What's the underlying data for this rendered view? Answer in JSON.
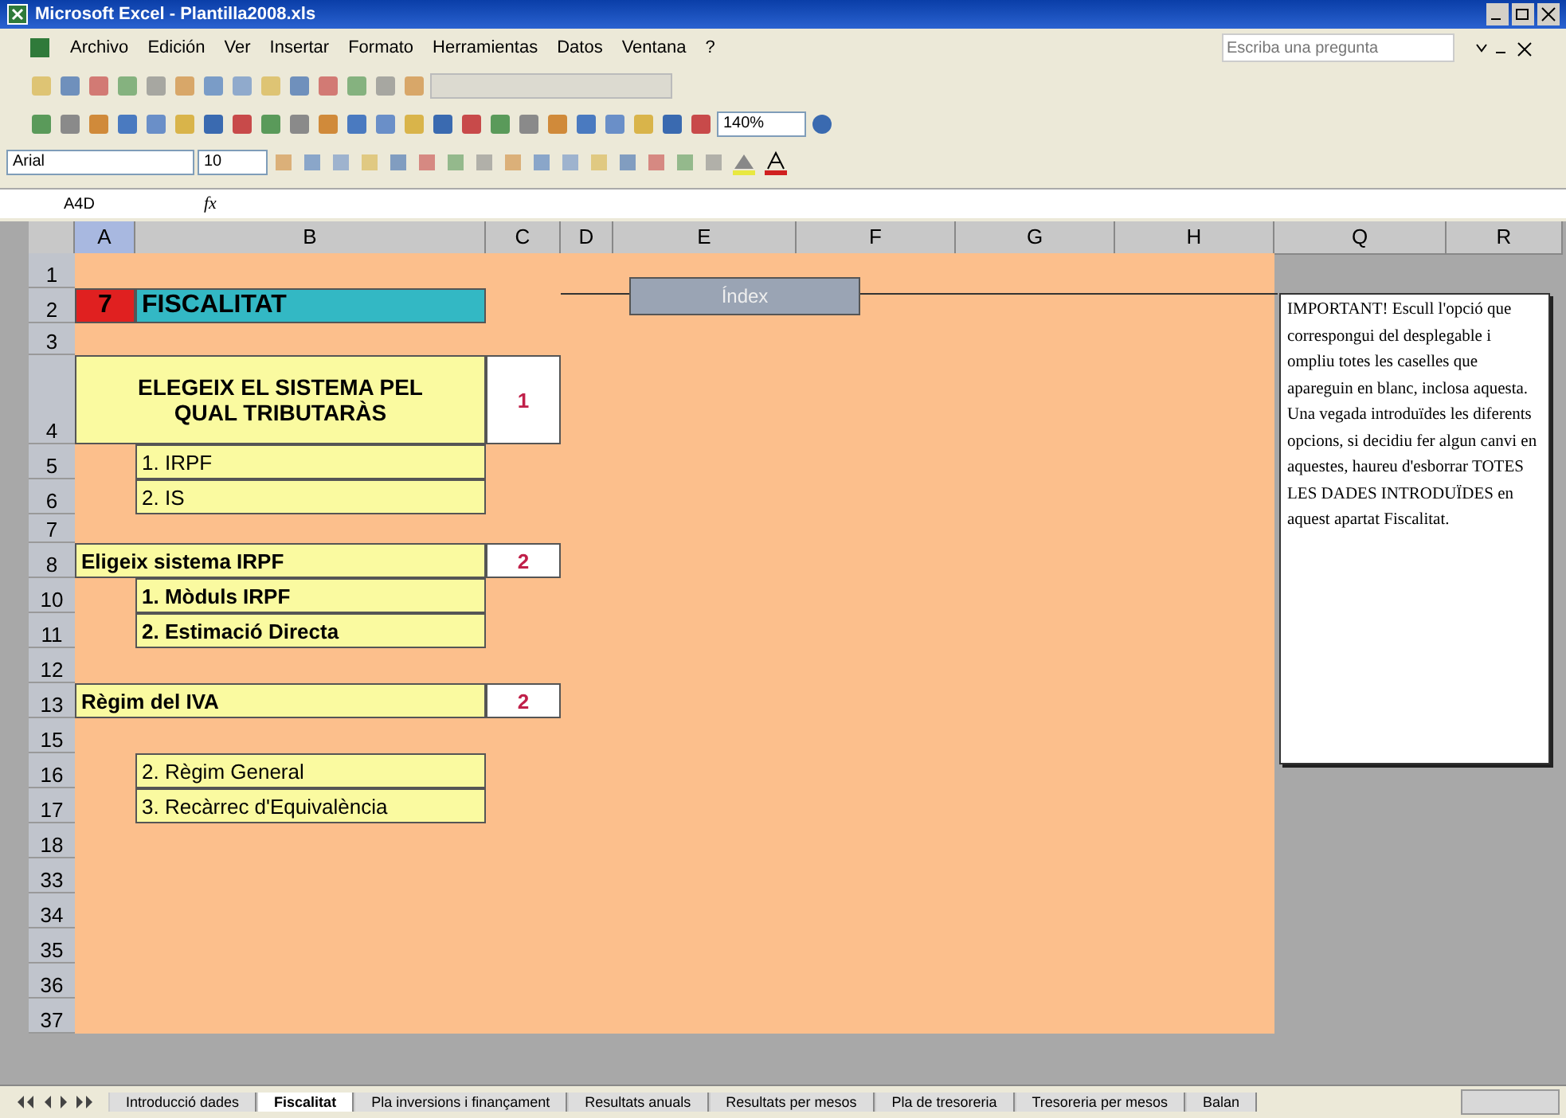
{
  "window": {
    "title": "Microsoft Excel - Plantilla2008.xls"
  },
  "menu": [
    "Archivo",
    "Edición",
    "Ver",
    "Insertar",
    "Formato",
    "Herramientas",
    "Datos",
    "Ventana",
    "?"
  ],
  "help_box": {
    "placeholder": "Escriba una pregunta"
  },
  "toolbar": {
    "zoom": "140%",
    "font": "Arial",
    "font_size": "10"
  },
  "formula_bar": {
    "name_box": "A4D",
    "fx": "fx"
  },
  "columns": [
    {
      "label": "A",
      "selected": true
    },
    {
      "label": "B",
      "selected": false
    },
    {
      "label": "C",
      "selected": false
    },
    {
      "label": "D",
      "selected": false
    },
    {
      "label": "E",
      "selected": false
    },
    {
      "label": "F",
      "selected": false
    },
    {
      "label": "G",
      "selected": false
    },
    {
      "label": "H",
      "selected": false
    },
    {
      "label": "Q",
      "selected": false
    },
    {
      "label": "R",
      "selected": false
    }
  ],
  "rows": [
    {
      "number": "1",
      "cells": []
    },
    {
      "number": "2",
      "cells": [
        {
          "kind": "section-number",
          "text": "7"
        },
        {
          "kind": "title",
          "text": "FISCALITAT"
        }
      ]
    },
    {
      "number": "3",
      "cells": []
    },
    {
      "number": "4",
      "cells": [
        {
          "kind": "heading",
          "text": "ELEGEIX EL SISTEMA PEL QUAL TRIBUTARÀS"
        },
        {
          "kind": "value",
          "text": "1"
        }
      ]
    },
    {
      "number": "5",
      "cells": [
        {
          "kind": "option",
          "text": "1. IRPF"
        }
      ]
    },
    {
      "number": "6",
      "cells": [
        {
          "kind": "option",
          "text": "2. IS"
        }
      ]
    },
    {
      "number": "7",
      "cells": []
    },
    {
      "number": "8",
      "cells": [
        {
          "kind": "label",
          "text": "Eligeix sistema IRPF"
        },
        {
          "kind": "value",
          "text": "2"
        }
      ]
    },
    {
      "number": "10",
      "cells": [
        {
          "kind": "bold-option",
          "text": "1. Mòduls IRPF"
        }
      ]
    },
    {
      "number": "11",
      "cells": [
        {
          "kind": "bold-option",
          "text": "2. Estimació Directa"
        }
      ]
    },
    {
      "number": "12",
      "cells": []
    },
    {
      "number": "13",
      "cells": [
        {
          "kind": "label",
          "text": "Règim del IVA"
        },
        {
          "kind": "value",
          "text": "2"
        }
      ]
    },
    {
      "number": "15",
      "cells": []
    },
    {
      "number": "16",
      "cells": [
        {
          "kind": "option",
          "text": "2. Règim General"
        }
      ]
    },
    {
      "number": "17",
      "cells": [
        {
          "kind": "option",
          "text": "3. Recàrrec d'Equivalència"
        }
      ]
    },
    {
      "number": "18",
      "cells": []
    },
    {
      "number": "33",
      "cells": []
    },
    {
      "number": "34",
      "cells": []
    },
    {
      "number": "35",
      "cells": []
    },
    {
      "number": "36",
      "cells": []
    },
    {
      "number": "37",
      "cells": []
    }
  ],
  "index_button": "Índex",
  "note": "IMPORTANT! Escull l'opció que correspongui del desplegable i ompliu totes les caselles que apareguin en blanc, inclosa aquesta. Una vegada introduïdes les diferents opcions, si decidiu fer algun canvi en aquestes, haureu d'esborrar TOTES LES DADES INTRODUÏDES en aquest apartat Fiscalitat.",
  "sheet_tabs": [
    {
      "label": "Introducció dades",
      "selected": false
    },
    {
      "label": "Fiscalitat",
      "selected": true
    },
    {
      "label": "Pla inversions i finançament",
      "selected": false
    },
    {
      "label": "Resultats anuals",
      "selected": false
    },
    {
      "label": "Resultats per mesos",
      "selected": false
    },
    {
      "label": "Pla de tresoreria",
      "selected": false
    },
    {
      "label": "Tresoreria per mesos",
      "selected": false
    },
    {
      "label": "Balan",
      "selected": false
    }
  ]
}
